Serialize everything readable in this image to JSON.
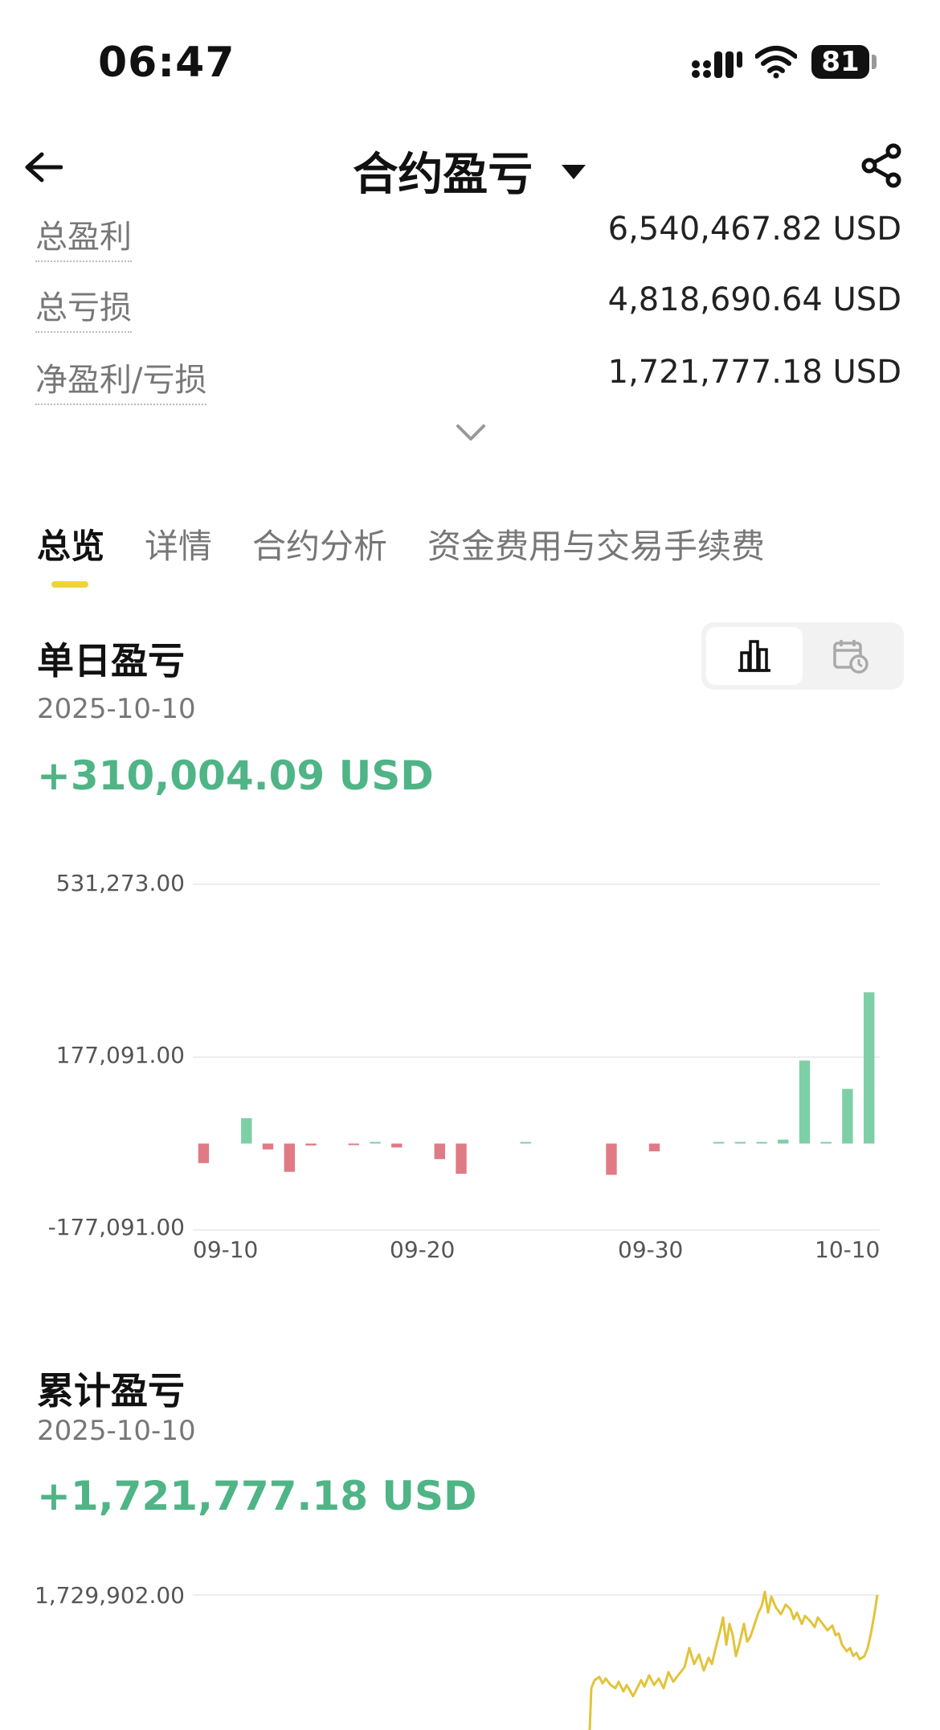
{
  "status_bar": {
    "time": "06:47",
    "battery": "81"
  },
  "header": {
    "title": "合约盈亏"
  },
  "summary": [
    {
      "label": "总盈利",
      "value": "6,540,467.82 USD"
    },
    {
      "label": "总亏损",
      "value": "4,818,690.64 USD"
    },
    {
      "label": "净盈利/亏损",
      "value": "1,721,777.18 USD"
    }
  ],
  "tabs": [
    "总览",
    "详情",
    "合约分析",
    "资金费用与交易手续费"
  ],
  "daily": {
    "title": "单日盈亏",
    "date": "2025-10-10",
    "value": "+310,004.09 USD"
  },
  "cumulative": {
    "title": "累计盈亏",
    "date": "2025-10-10",
    "value": "+1,721,777.18 USD"
  },
  "colors": {
    "positive": "#7fcfa6",
    "negative": "#e07b86",
    "line": "#e3c33a",
    "accent": "#f0d33a"
  },
  "chart_data": [
    {
      "type": "bar",
      "ylim": [
        -177091,
        531273
      ],
      "yticks_values": [
        531273,
        177091,
        -177091
      ],
      "yticks": [
        "531,273.00",
        "177,091.00",
        "-177,091.00"
      ],
      "xticks": [
        "09-10",
        "09-20",
        "09-30",
        "10-10"
      ],
      "x": [
        "09-10",
        "09-11",
        "09-12",
        "09-13",
        "09-14",
        "09-15",
        "09-16",
        "09-17",
        "09-18",
        "09-19",
        "09-20",
        "09-21",
        "09-22",
        "09-23",
        "09-24",
        "09-25",
        "09-26",
        "09-27",
        "09-28",
        "09-29",
        "09-30",
        "10-01",
        "10-02",
        "10-03",
        "10-04",
        "10-05",
        "10-06",
        "10-07",
        "10-08",
        "10-09",
        "10-10"
      ],
      "values": [
        -40000,
        0,
        52000,
        -12000,
        -58000,
        -4000,
        0,
        -2000,
        2000,
        -8000,
        0,
        -32000,
        -62000,
        0,
        0,
        1000,
        0,
        0,
        0,
        -64000,
        0,
        -16000,
        0,
        0,
        1500,
        2000,
        1500,
        8000,
        170000,
        1500,
        112000,
        310004
      ]
    },
    {
      "type": "line",
      "ylim_top": 1729902,
      "yticks": [
        "1,729,902.00"
      ],
      "note_range": "visible portion only"
    }
  ]
}
